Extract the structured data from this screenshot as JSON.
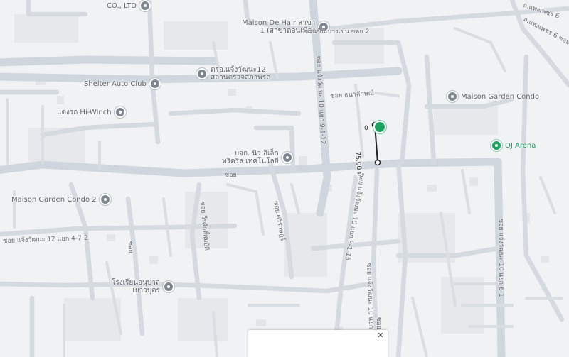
{
  "map": {
    "pois": [
      {
        "id": "co-ltd",
        "label": "CO., LTD",
        "style": "gray"
      },
      {
        "id": "maison-de-hair",
        "label": "Maison De Hair สาขา\n1 (สาขาดอนเมือง",
        "style": "gray"
      },
      {
        "id": "jaeng",
        "label": "ตรอ.แจ้งวัฒนะ12\nสถานตรวจสภาพรถ",
        "style": "gray"
      },
      {
        "id": "shelter",
        "label": "Shelter Auto Club",
        "style": "gray"
      },
      {
        "id": "maison-garden",
        "label": "Maison Garden Condo",
        "style": "gray"
      },
      {
        "id": "hiwinch",
        "label": "แต่งรถ Hi-Winch",
        "style": "gray"
      },
      {
        "id": "oj-arena",
        "label": "OJ Arena",
        "style": "green"
      },
      {
        "id": "bkj",
        "label": "บจก. นิว อิเล็ก\nทริคริล เทคโนโลยี",
        "style": "gray"
      },
      {
        "id": "maison-garden-2",
        "label": "Maison Garden Condo 2",
        "style": "gray"
      },
      {
        "id": "school",
        "label": "โรงเรียนอนุบาล\nเยาวบุตร",
        "style": "gray"
      }
    ],
    "road_labels": [
      {
        "id": "r1",
        "text": "ชวนชื่น บางเขน ซอย 2"
      },
      {
        "id": "r2",
        "text": "ซอย แจ้งวัฒนะ 10 แยก 9-1-12"
      },
      {
        "id": "r3",
        "text": "ซอย ธนาลักษณ์"
      },
      {
        "id": "r4",
        "text": "ซอย"
      },
      {
        "id": "r5",
        "text": "ซอย แจ้งวัฒนะ 10 แยก 9-1-15"
      },
      {
        "id": "r6",
        "text": "ซอย แจ้งวัฒนะ 12 แยก 4-7-2"
      },
      {
        "id": "r7",
        "text": "ซอย วีรศักดิ์สมบัติ"
      },
      {
        "id": "r8",
        "text": "ซอย ศรีราษฎร์"
      },
      {
        "id": "r9",
        "text": "ซอย"
      },
      {
        "id": "r10",
        "text": "ซอย แจ้งวัฒนะ 10 แยก 9-1-13"
      },
      {
        "id": "r11",
        "text": "ซอย แจ้งวัฒนะ 10 แยก 6-1"
      },
      {
        "id": "r12",
        "text": "ซอย"
      },
      {
        "id": "r13",
        "text": "ถ.แพงเพชร 6 ซอย 1"
      },
      {
        "id": "r14",
        "text": "ถ.แพงเพชร 6"
      }
    ],
    "measurement": {
      "distance_label": "75.00 ม.",
      "start_label": "0"
    },
    "close_symbol": "✕"
  }
}
